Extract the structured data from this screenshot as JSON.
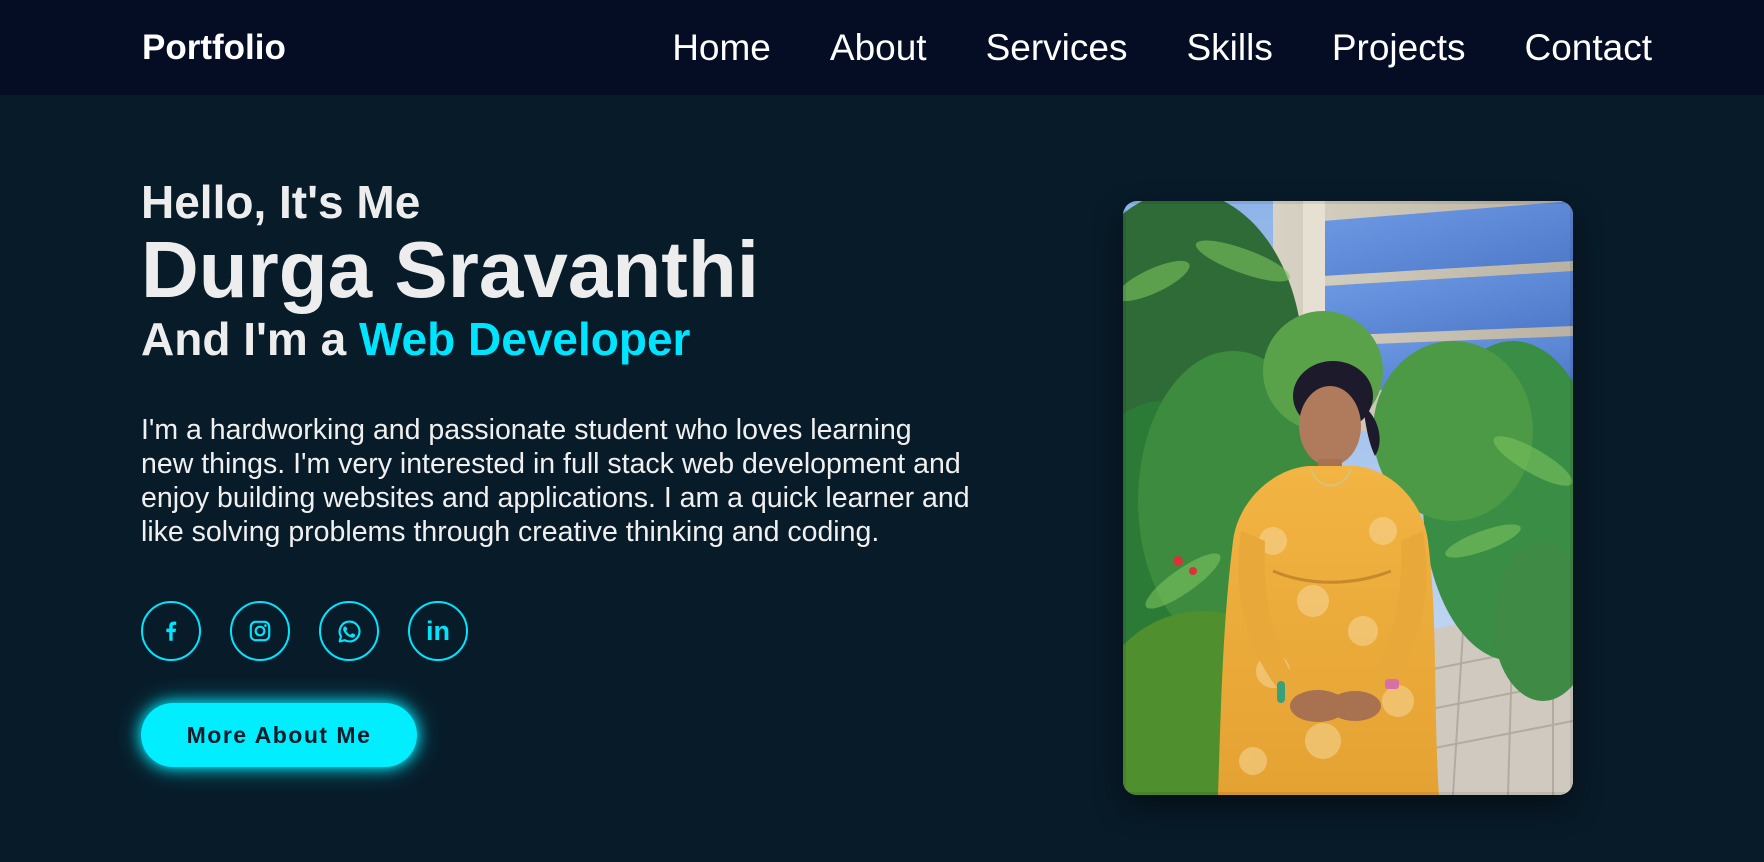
{
  "header": {
    "logo": "Portfolio",
    "nav": [
      {
        "label": "Home"
      },
      {
        "label": "About"
      },
      {
        "label": "Services"
      },
      {
        "label": "Skills"
      },
      {
        "label": "Projects"
      },
      {
        "label": "Contact"
      }
    ]
  },
  "home": {
    "greeting": "Hello, It's Me",
    "name": "Durga Sravanthi",
    "role_prefix": "And I'm a ",
    "role_highlight": "Web Developer",
    "bio": "I'm a hardworking and passionate student who loves learning new things. I'm very interested in full stack web development and enjoy building websites and applications. I am a quick learner and like solving problems through creative thinking and coding.",
    "social": [
      {
        "icon": "facebook-icon"
      },
      {
        "icon": "instagram-icon"
      },
      {
        "icon": "whatsapp-icon"
      },
      {
        "icon": "linkedin-icon",
        "glyph": "in"
      }
    ],
    "button_label": "More About Me",
    "photo": {
      "alt": "profile-photo"
    }
  },
  "colors": {
    "background": "#081b29",
    "header_background": "#050d24",
    "accent": "#00e5ff",
    "button": "#00eeff",
    "text": "#ededed"
  }
}
